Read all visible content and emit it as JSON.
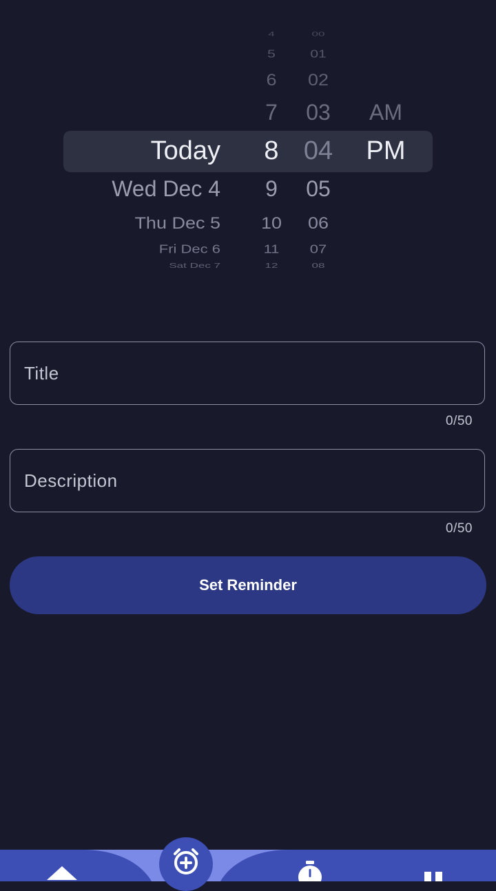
{
  "picker": {
    "date": [
      {
        "label": "Today",
        "selected": true
      },
      {
        "label": "Wed Dec 4"
      },
      {
        "label": "Thu Dec 5"
      },
      {
        "label": "Fri Dec 6"
      },
      {
        "label": "Sat Dec 7"
      }
    ],
    "hour": {
      "above": [
        "4",
        "5",
        "6",
        "7"
      ],
      "selected": "8",
      "below": [
        "9",
        "10",
        "11",
        "12"
      ]
    },
    "minute": {
      "above": [
        "00",
        "01",
        "02",
        "03"
      ],
      "selected": "04",
      "below": [
        "05",
        "06",
        "07",
        "08"
      ]
    },
    "ampm": {
      "above": [
        "AM"
      ],
      "selected": "PM"
    }
  },
  "form": {
    "title_placeholder": "Title",
    "title_counter": "0/50",
    "description_placeholder": "Description",
    "description_counter": "0/50",
    "submit_label": "Set Reminder"
  },
  "nav": {
    "items": [
      {
        "icon": "home-icon"
      },
      {
        "icon": "add-alarm-icon",
        "active": true
      },
      {
        "icon": "timer-icon"
      },
      {
        "icon": "pause-icon"
      }
    ]
  },
  "colors": {
    "background": "#181a2c",
    "picker_highlight": "#2e3142",
    "button": "#2d3884",
    "nav_bar": "#3d4eb5",
    "nav_active": "#7a8ae6"
  }
}
